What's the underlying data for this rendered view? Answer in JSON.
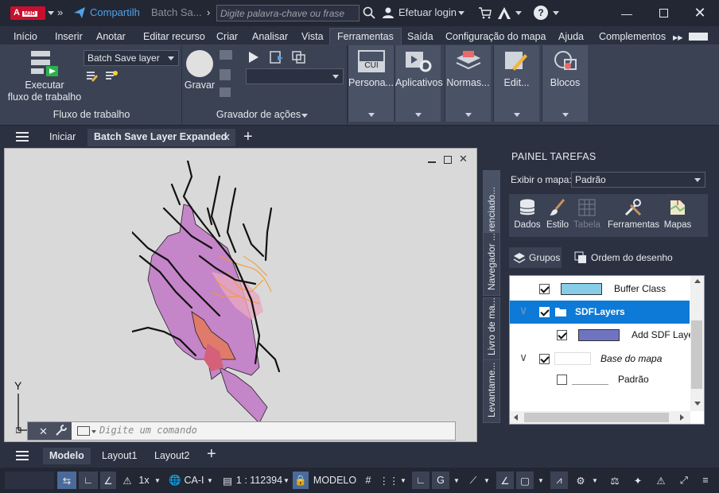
{
  "titlebar": {
    "app_logo": "A",
    "app_badge": "M3D",
    "share_label": "Compartilh",
    "file_name": "Batch Sa...",
    "search_placeholder": "Digite palavra-chave ou frase",
    "login_label": "Efetuar login"
  },
  "menu": {
    "tabs": [
      "Início",
      "Inserir",
      "Anotar",
      "Editar recurso",
      "Criar",
      "Analisar",
      "Vista",
      "Ferramentas",
      "Saída",
      "Configuração do mapa",
      "Ajuda",
      "Complementos"
    ],
    "active": "Ferramentas"
  },
  "ribbon": {
    "workflow": {
      "run_label_1": "Executar",
      "run_label_2": "fluxo de trabalho",
      "dropdown_value": "Batch Save layer",
      "panel_title": "Fluxo de trabalho"
    },
    "recorder": {
      "record_label": "Gravar",
      "panel_title": "Gravador de ações",
      "dropdown_value": ""
    },
    "big_tools": [
      "Persona...",
      "Aplicativos",
      "Normas...",
      "Edit...",
      "Blocos"
    ],
    "cui_badge": "CUI"
  },
  "doc_tabs": {
    "start": "Iniciar",
    "active": "Batch Save Layer Expanded"
  },
  "drawing": {
    "command_placeholder": "Digite um comando",
    "ucs_y": "Y"
  },
  "task_panel": {
    "title": "PAINEL TAREFAS",
    "vertical_tabs": [
      "Gerenciado...",
      "Navegador ...",
      "Livro de ma...",
      "Levantame..."
    ],
    "map_label": "Exibir o mapa:",
    "map_value": "Padrão",
    "tools": [
      "Dados",
      "Estilo",
      "Tabela",
      "Ferramentas",
      "Mapas"
    ],
    "groups_label": "Grupos",
    "draw_order_label": "Ordem do desenho",
    "layers": [
      {
        "name": "Buffer Class",
        "checked": true,
        "swatch": "#87cde8"
      },
      {
        "name": "SDFLayers",
        "checked": true,
        "selected": true
      },
      {
        "name": "Add SDF Laye",
        "checked": true,
        "swatch": "#6f74c0"
      },
      {
        "name": "Base do mapa",
        "checked": true,
        "italic": true
      },
      {
        "name": "Padrão",
        "checked": false
      }
    ]
  },
  "layouts": {
    "tabs": [
      "Modelo",
      "Layout1",
      "Layout2"
    ],
    "active": "Modelo"
  },
  "status": {
    "scale_factor": "1x",
    "coordsys": "CA-I",
    "map_scale": "1 : 112394",
    "space": "MODELO"
  }
}
